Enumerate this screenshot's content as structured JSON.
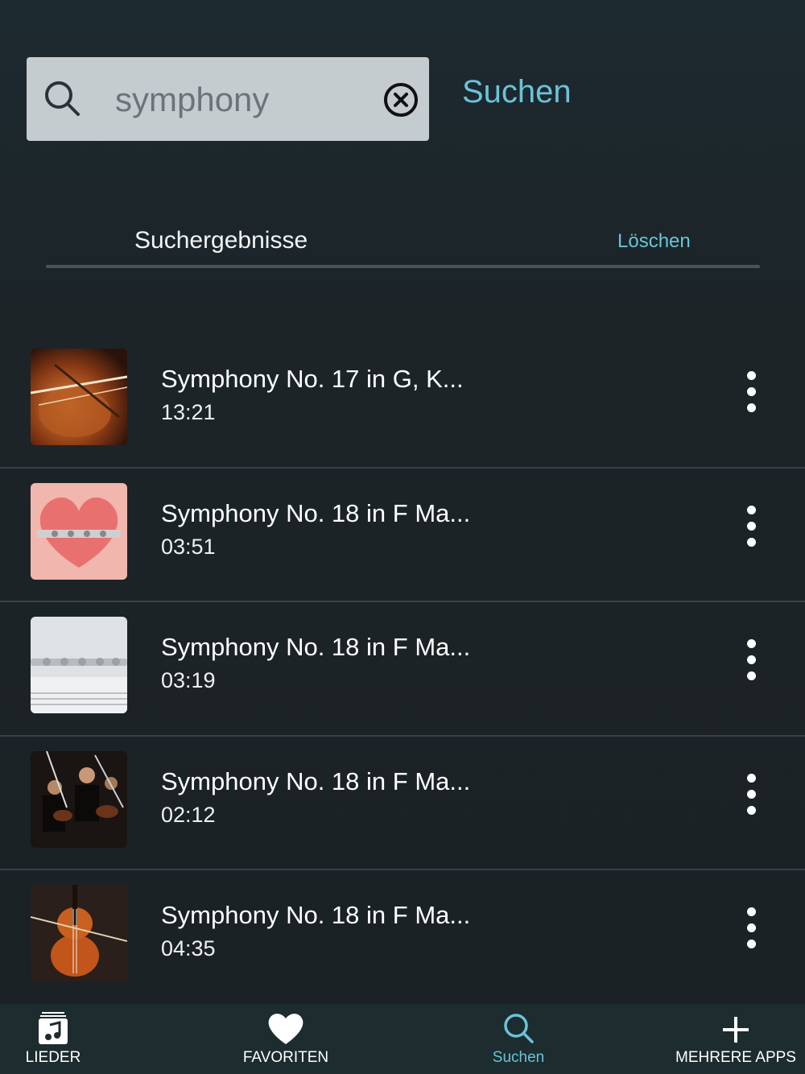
{
  "search": {
    "value": "symphony",
    "placeholder": "",
    "submit_label": "Suchen"
  },
  "results": {
    "header": "Suchergebnisse",
    "clear_label": "Löschen",
    "items": [
      {
        "title": "Symphony No. 17 in G, K...",
        "duration": "13:21",
        "thumb": "violin-closeup"
      },
      {
        "title": "Symphony No. 18 in F Ma...",
        "duration": "03:51",
        "thumb": "flute-heart"
      },
      {
        "title": "Symphony No. 18 in F Ma...",
        "duration": "03:19",
        "thumb": "flute-sheet"
      },
      {
        "title": "Symphony No. 18 in F Ma...",
        "duration": "02:12",
        "thumb": "orchestra"
      },
      {
        "title": "Symphony No. 18 in F Ma...",
        "duration": "04:35",
        "thumb": "cello"
      }
    ]
  },
  "tabbar": {
    "tabs": [
      {
        "label": "LIEDER",
        "icon": "music-list-icon"
      },
      {
        "label": "FAVORITEN",
        "icon": "heart-icon"
      },
      {
        "label": "Suchen",
        "icon": "search-icon",
        "active": true
      },
      {
        "label": "MEHRERE APPS",
        "icon": "plus-icon"
      }
    ]
  },
  "colors": {
    "accent": "#6bc3d8",
    "background": "#1b2125",
    "search_box": "#c4ccd0"
  }
}
